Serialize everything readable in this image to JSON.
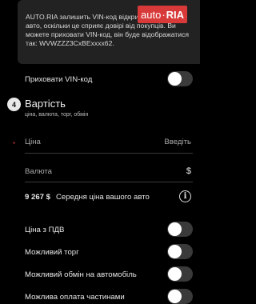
{
  "info": {
    "text": "AUTO.RIA залишить VIN-код відкритим на сторінці авто, оскільки це сприяє довірі від покупців. Ви можете приховати VIN-код, він буде відображатися так: WVWZZZ3CxBExxxx62."
  },
  "logo": {
    "part1": "auto",
    "part2": "RIA"
  },
  "hide_vin": {
    "label": "Приховати VIN-код",
    "enabled": false
  },
  "section": {
    "number": "4",
    "title": "Вартість",
    "subtitle": "ціна, валюта, торг, обмін"
  },
  "price_field": {
    "required_mark": "*",
    "label": "Ціна",
    "placeholder": "Введіть"
  },
  "currency_field": {
    "label": "Валюта",
    "symbol": "$"
  },
  "average": {
    "value": "9 267 $",
    "text": "Середня ціна вашого авто"
  },
  "toggles": [
    {
      "label": "Ціна з ПДВ",
      "enabled": false
    },
    {
      "label": "Можливий торг",
      "enabled": false
    },
    {
      "label": "Можливий обмін на автомобіль",
      "enabled": false
    },
    {
      "label": "Можлива оплата частинами",
      "enabled": false
    }
  ]
}
